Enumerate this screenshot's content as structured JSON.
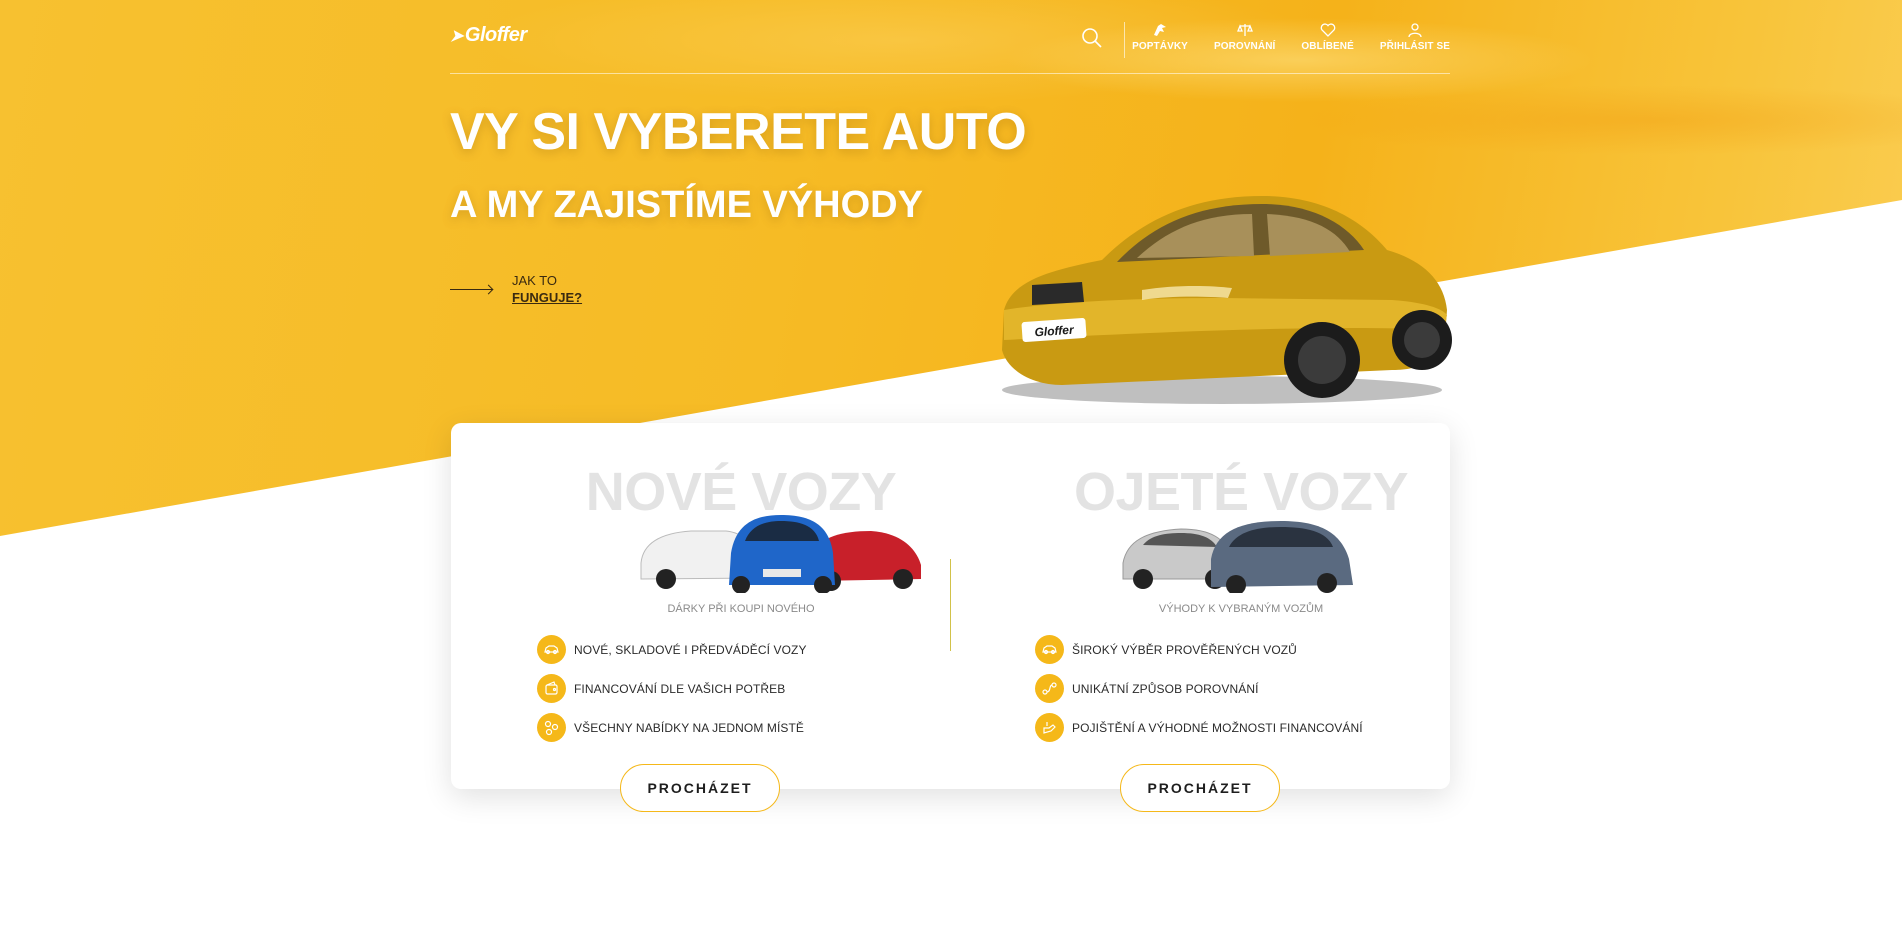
{
  "header": {
    "logo": "Gloffer",
    "nav": [
      {
        "label": "POPTÁVKY",
        "icon": "request-icon"
      },
      {
        "label": "POROVNÁNÍ",
        "icon": "compare-icon"
      },
      {
        "label": "OBLÍBENÉ",
        "icon": "heart-icon"
      },
      {
        "label": "PŘIHLÁSIT SE",
        "icon": "user-icon"
      }
    ]
  },
  "hero": {
    "headline1": "VY SI VYBERETE AUTO",
    "headline2": "A MY ZAJISTÍME VÝHODY",
    "how_line1": "JAK TO",
    "how_line2": "FUNGUJE?",
    "plate_text": "Gloffer"
  },
  "new_cars": {
    "watermark": "NOVÉ VOZY",
    "subtitle": "DÁRKY PŘI KOUPI NOVÉHO",
    "features": [
      {
        "text": "NOVÉ, SKLADOVÉ I PŘEDVÁDĚCÍ VOZY",
        "icon": "car-icon"
      },
      {
        "text": "FINANCOVÁNÍ DLE VAŠICH POTŘEB",
        "icon": "wallet-icon"
      },
      {
        "text": "VŠECHNY NABÍDKY NA JEDNOM MÍSTĚ",
        "icon": "offers-icon"
      }
    ],
    "button": "PROCHÁZET"
  },
  "used_cars": {
    "watermark": "OJETÉ VOZY",
    "subtitle": "VÝHODY K VYBRANÝM VOZŮM",
    "features": [
      {
        "text": "ŠIROKÝ VÝBĚR PROVĚŘENÝCH VOZŮ",
        "icon": "car-icon"
      },
      {
        "text": "UNIKÁTNÍ ZPŮSOB POROVNÁNÍ",
        "icon": "compare-route-icon"
      },
      {
        "text": "POJIŠTĚNÍ A VÝHODNÉ MOŽNOSTI FINANCOVÁNÍ",
        "icon": "insurance-icon"
      }
    ],
    "button": "PROCHÁZET"
  },
  "colors": {
    "accent": "#f5b819",
    "hero_yellow": "#f6bb25"
  }
}
